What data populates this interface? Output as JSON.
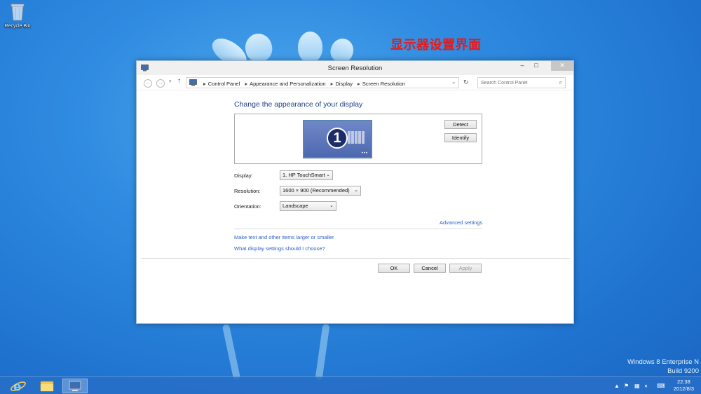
{
  "desktop": {
    "recycle_bin_label": "Recycle Bin",
    "overlay_title": "显示器设置界面",
    "watermark_line1": "Windows 8 Enterprise N",
    "watermark_line2": "Build 9200"
  },
  "window": {
    "title": "Screen Resolution",
    "controls": {
      "minimize": "–",
      "maximize": "□",
      "close": "✕"
    },
    "address": {
      "crumbs": [
        "Control Panel",
        "Appearance and Personalization",
        "Display",
        "Screen Resolution"
      ],
      "search_placeholder": "Search Control Panel"
    },
    "heading": "Change the appearance of your display",
    "monitor_number": "1",
    "detect_label": "Detect",
    "identify_label": "Identify",
    "fields": {
      "display_label": "Display:",
      "display_value": "1. HP TouchSmart",
      "resolution_label": "Resolution:",
      "resolution_value": "1600 × 900 (Recommended)",
      "orientation_label": "Orientation:",
      "orientation_value": "Landscape"
    },
    "links": {
      "advanced": "Advanced settings",
      "text_size": "Make text and other items larger or smaller",
      "which_settings": "What display settings should I choose?"
    },
    "buttons": {
      "ok": "OK",
      "cancel": "Cancel",
      "apply": "Apply"
    }
  },
  "taskbar": {
    "time": "22:38",
    "date": "2012/8/3"
  },
  "colors": {
    "desktop_blue": "#2f8be0",
    "link_blue": "#2a5fc7",
    "heading_blue": "#1e3f8a",
    "overlay_red": "#e61a1a"
  }
}
